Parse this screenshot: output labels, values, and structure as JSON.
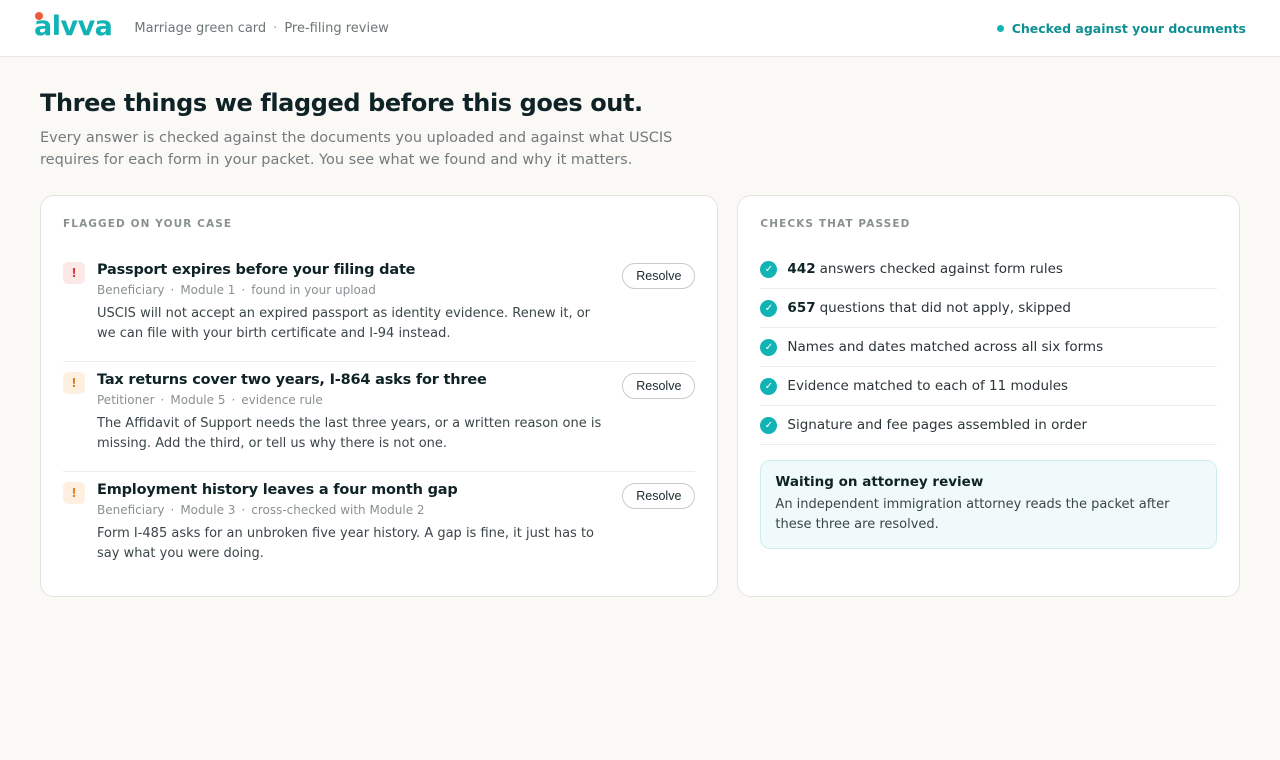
{
  "app": {
    "logo_text": "alvva",
    "breadcrumb": [
      "Marriage green card",
      "Pre-filing review"
    ],
    "status": "Checked against your documents"
  },
  "page": {
    "title": "Three things we flagged before this goes out.",
    "subtitle": "Every answer is checked against the documents you uploaded and against what USCIS requires for each form in your packet. You see what we found and why it matters."
  },
  "flagged": {
    "label": "Flagged on your case",
    "resolve_label": "Resolve",
    "items": [
      {
        "severity": "high",
        "title": "Passport expires before your filing date",
        "meta": [
          "Beneficiary",
          "Module 1",
          "found in your upload"
        ],
        "description": "USCIS will not accept an expired passport as identity evidence. Renew it, or we can file with your birth certificate and I-94 instead."
      },
      {
        "severity": "medium",
        "title": "Tax returns cover two years, I-864 asks for three",
        "meta": [
          "Petitioner",
          "Module 5",
          "evidence rule"
        ],
        "description": "The Affidavit of Support needs the last three years, or a written reason one is missing. Add the third, or tell us why there is not one."
      },
      {
        "severity": "medium",
        "title": "Employment history leaves a four month gap",
        "meta": [
          "Beneficiary",
          "Module 3",
          "cross-checked with Module 2"
        ],
        "description": "Form I-485 asks for an unbroken five year history. A gap is fine, it just has to say what you were doing."
      }
    ]
  },
  "passed": {
    "label": "Checks that passed",
    "items": [
      {
        "count": "442",
        "text": "answers checked against form rules"
      },
      {
        "count": "657",
        "text": "questions that did not apply, skipped"
      },
      {
        "count": "",
        "text": "Names and dates matched across all six forms"
      },
      {
        "count": "",
        "text": "Evidence matched to each of 11 modules"
      },
      {
        "count": "",
        "text": "Signature and fee pages assembled in order"
      }
    ],
    "review": {
      "title": "Waiting on attorney review",
      "text": "An independent immigration attorney reads the packet after these three are resolved."
    }
  },
  "colors": {
    "brand": "#12b3b5",
    "logo_dot": "#f05a3c",
    "flag_high": "#d63b3b",
    "flag_medium": "#d9822b"
  }
}
